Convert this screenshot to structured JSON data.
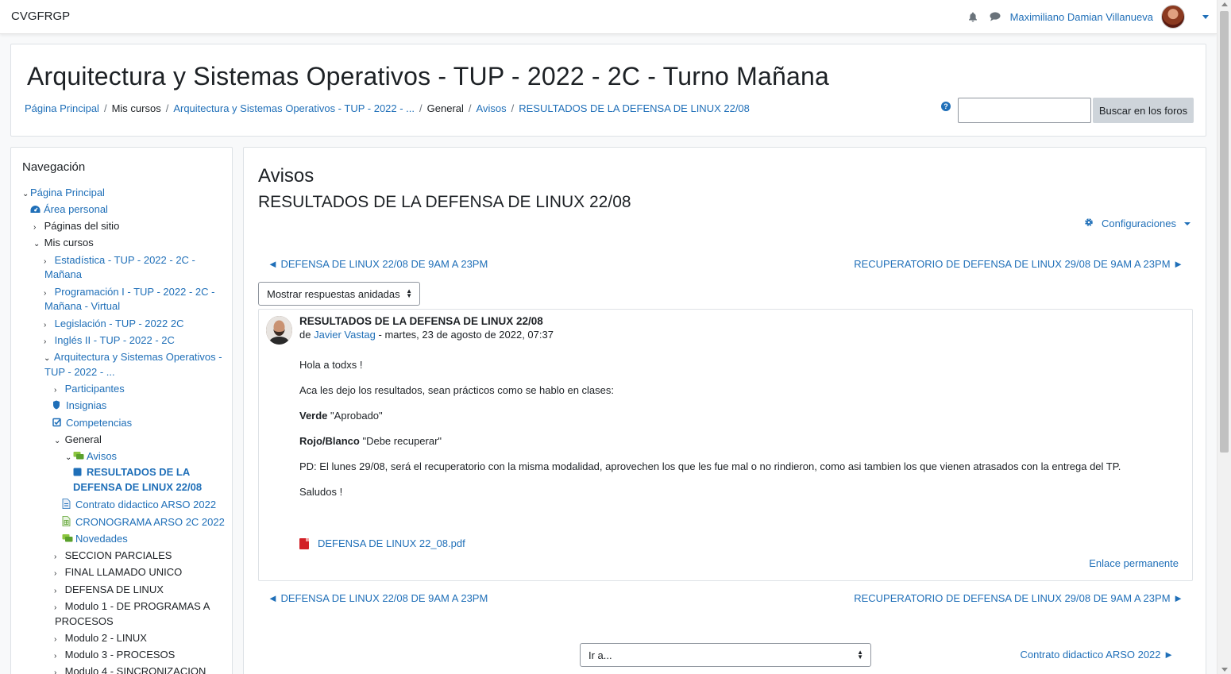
{
  "site": {
    "brand": "CVGFRGP"
  },
  "user": {
    "name": "Maximiliano Damian Villanueva"
  },
  "header": {
    "course_title": "Arquitectura y Sistemas Operativos - TUP - 2022 - 2C - Turno Mañana",
    "breadcrumb": [
      "Página Principal",
      "Mis cursos",
      "Arquitectura y Sistemas Operativos - TUP - 2022 - ...",
      "General",
      "Avisos",
      "RESULTADOS DE LA DEFENSA DE LINUX 22/08"
    ],
    "search_button": "Buscar en los foros",
    "search_placeholder": ""
  },
  "navigation": {
    "title": "Navegación",
    "items": [
      "Página Principal",
      "Área personal",
      "Páginas del sitio",
      "Mis cursos",
      "Estadística - TUP - 2022 - 2C -",
      "Mañana",
      "Programación I - TUP - 2022 - 2C -",
      "Mañana - Virtual",
      "Legislación - TUP - 2022 2C",
      "Inglés II - TUP - 2022 - 2C",
      "Arquitectura y Sistemas Operativos -",
      "TUP - 2022 - ...",
      "Participantes",
      "Insignias",
      "Competencias",
      "General",
      "Avisos",
      "RESULTADOS DE LA",
      "DEFENSA DE LINUX 22/08",
      "Contrato didactico ARSO 2022",
      "CRONOGRAMA ARSO 2C 2022",
      "Novedades",
      "SECCION PARCIALES",
      "FINAL LLAMADO UNICO",
      "DEFENSA DE LINUX",
      "Modulo 1 - DE PROGRAMAS A",
      "PROCESOS",
      "Modulo 2 - LINUX",
      "Modulo 3 - PROCESOS",
      "Modulo 4 - SINCRONIZACION"
    ]
  },
  "main": {
    "forum_name": "Avisos",
    "discussion_name": "RESULTADOS DE LA DEFENSA DE LINUX 22/08",
    "settings_label": "Configuraciones",
    "prev_discussion": "◄ DEFENSA DE LINUX 22/08 DE 9AM A 23PM",
    "next_discussion": "RECUPERATORIO DE DEFENSA DE LINUX 29/08 DE 9AM A 23PM ►",
    "display_mode": "Mostrar respuestas anidadas",
    "post": {
      "subject": "RESULTADOS DE LA DEFENSA DE LINUX 22/08",
      "by_prefix": "de",
      "author": "Javier Vastag",
      "date": "- martes, 23 de agosto de 2022, 07:37",
      "greeting": "Hola a todxs !",
      "intro": "Aca les dejo los resultados, sean prácticos como se hablo en clases:",
      "green_label": "Verde",
      "green_text": "\"Aprobado\"",
      "red_label": "Rojo/Blanco",
      "red_text": "\"Debe recuperar\"",
      "ps": "PD: El lunes 29/08, será el recuperatorio con la misma modalidad, aprovechen los que les fue mal o no rindieron, como asi tambien los que vienen atrasados con la entrega del TP.",
      "bye": "Saludos !",
      "attachment": "DEFENSA DE LINUX 22_08.pdf",
      "permalink": "Enlace permanente"
    },
    "jump_select": "Ir a...",
    "next_activity": "Contrato didactico ARSO 2022 ►"
  }
}
